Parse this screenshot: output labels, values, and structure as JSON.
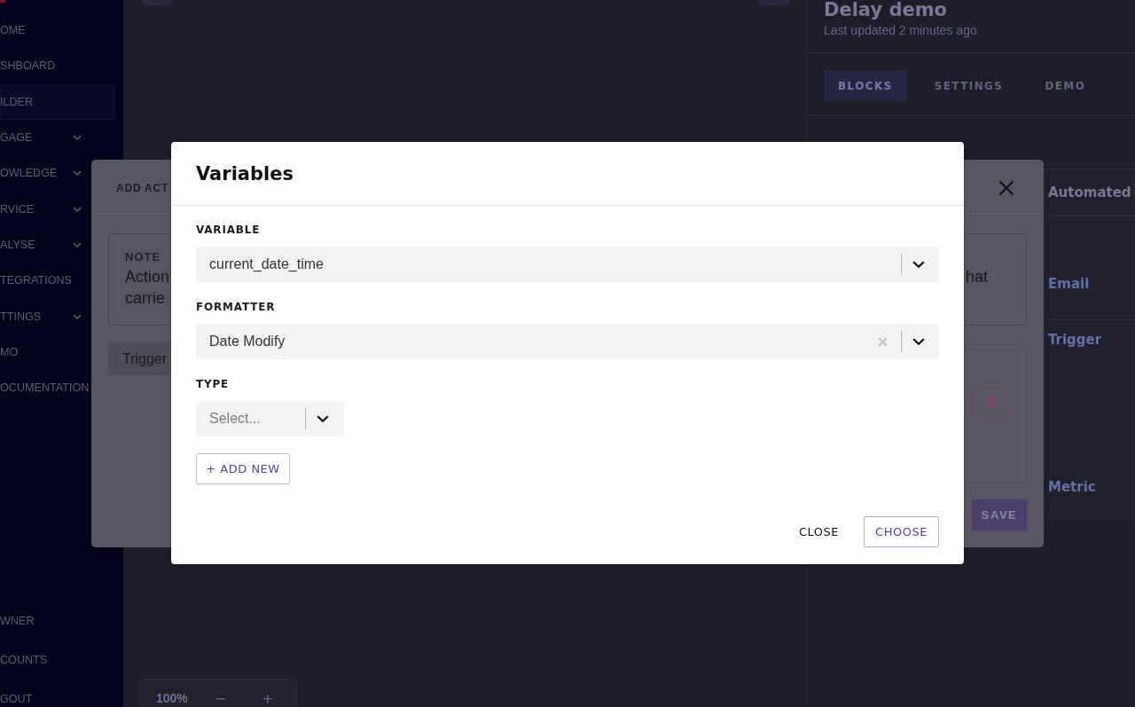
{
  "sidebar": {
    "items": [
      {
        "label": "OME",
        "selected": false,
        "expandable": false
      },
      {
        "label": "SHBOARD",
        "selected": false,
        "expandable": false
      },
      {
        "label": "ILDER",
        "selected": true,
        "expandable": false
      },
      {
        "label": "GAGE",
        "selected": false,
        "expandable": true
      },
      {
        "label": "OWLEDGE",
        "selected": false,
        "expandable": true
      },
      {
        "label": "RVICE",
        "selected": false,
        "expandable": true
      },
      {
        "label": "ALYSE",
        "selected": false,
        "expandable": true
      },
      {
        "label": "TEGRATIONS",
        "selected": false,
        "expandable": false
      },
      {
        "label": "TTINGS",
        "selected": false,
        "expandable": true
      },
      {
        "label": "MO",
        "selected": false,
        "expandable": false
      },
      {
        "label": "OCUMENTATION",
        "selected": false,
        "expandable": false
      }
    ],
    "bottom_items": [
      "WNER",
      "COUNTS",
      "GOUT"
    ]
  },
  "canvas": {
    "zoom": {
      "level": "100%",
      "minus": "−",
      "plus": "+"
    }
  },
  "flow": {
    "title": "Delay demo",
    "updated": "Last updated 2 minutes ago",
    "tabs": [
      {
        "label": "BLOCKS",
        "selected": true
      },
      {
        "label": "SETTINGS",
        "selected": false
      },
      {
        "label": "DEMO",
        "selected": false
      }
    ],
    "panel": {
      "title": "Automated",
      "items": [
        "Email",
        "Trigger",
        "Metric"
      ]
    }
  },
  "add_action": {
    "title": "ADD ACT",
    "note": {
      "label": "NOTE",
      "lines": [
        "Action",
        "carrie"
      ],
      "tail": "hat"
    },
    "trigger": "Trigger",
    "save": "SAVE"
  },
  "variables": {
    "title": "Variables",
    "fields": [
      {
        "label": "VARIABLE",
        "value": "current_date_time",
        "clearable": false
      },
      {
        "label": "FORMATTER",
        "value": "Date Modify",
        "clearable": true
      },
      {
        "label": "TYPE",
        "placeholder": "Select...",
        "clearable": false
      }
    ],
    "add_button": "+ ADD NEW",
    "buttons": [
      {
        "label": "CLOSE",
        "kind": "text"
      },
      {
        "label": "CHOOSE",
        "kind": "outline"
      }
    ]
  }
}
